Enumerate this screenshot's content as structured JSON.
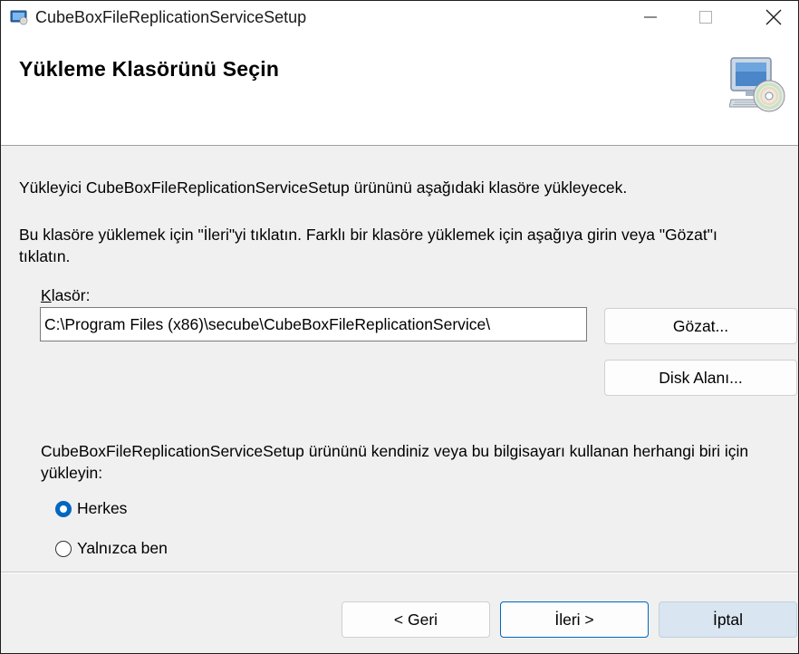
{
  "window": {
    "title": "CubeBoxFileReplicationServiceSetup",
    "controls": {
      "minimize": "—",
      "maximize": "□",
      "close": "✕"
    }
  },
  "banner": {
    "title": "Yükleme Klasörünü Seçin",
    "icon": "computer-cd-icon"
  },
  "body": {
    "intro": "Yükleyici CubeBoxFileReplicationServiceSetup ürününü aşağıdaki klasöre yükleyecek.",
    "instruction": "Bu klasöre yüklemek için \"İleri\"yi tıklatın. Farklı bir klasöre yüklemek için aşağıya girin veya \"Gözat\"ı tıklatın.",
    "folder_label_accel": "K",
    "folder_label_rest": "lasör:",
    "folder_value": "C:\\Program Files (x86)\\secube\\CubeBoxFileReplicationService\\",
    "browse_label": "Gözat...",
    "disk_space_label": "Disk Alanı...",
    "install_for_text": "CubeBoxFileReplicationServiceSetup ürününü kendiniz veya bu bilgisayarı kullanan herhangi biri için yükleyin:",
    "radio_options": [
      {
        "label": "Herkes",
        "checked": true
      },
      {
        "label": "Yalnızca ben",
        "checked": false
      }
    ]
  },
  "footer": {
    "back_label": "< Geri",
    "next_label": "İleri >",
    "cancel_label": "İptal"
  },
  "colors": {
    "accent": "#0067c0",
    "dialog_bg": "#f0f0f0",
    "cancel_bg": "#d9e5f1"
  }
}
